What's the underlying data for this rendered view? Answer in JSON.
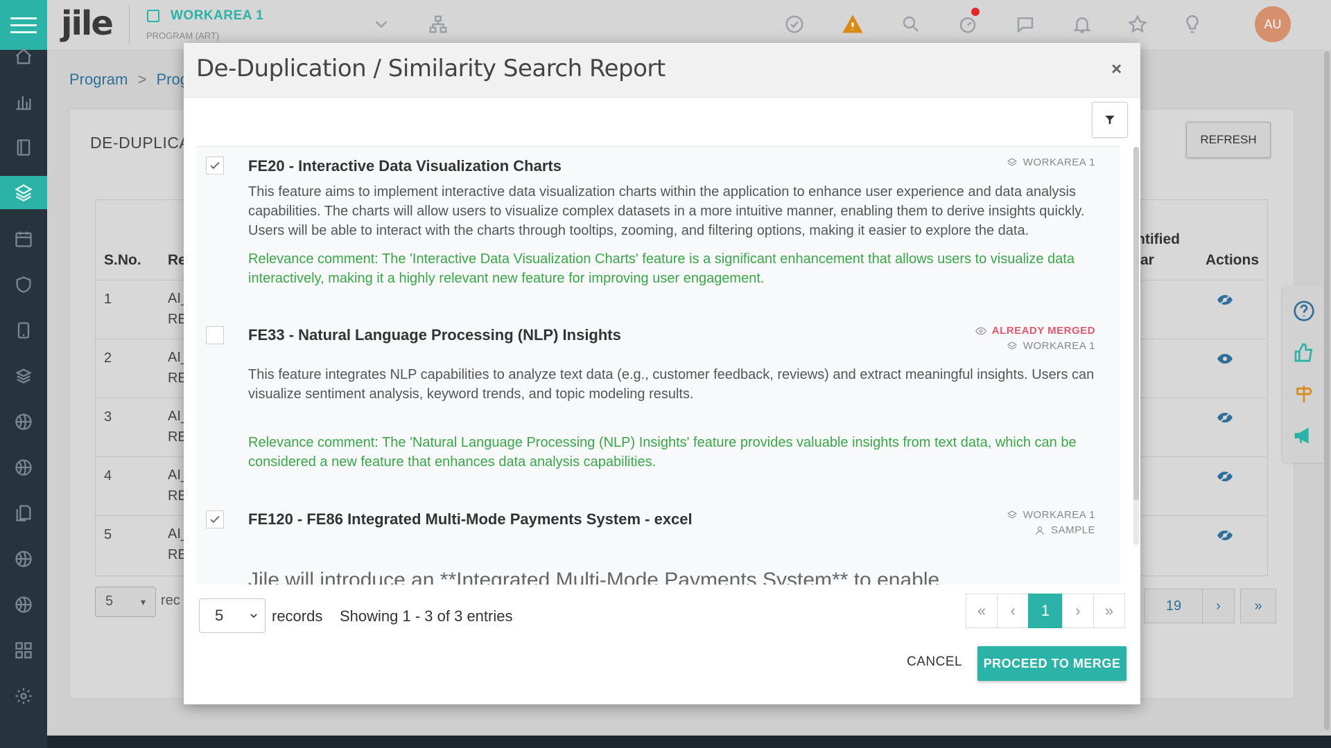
{
  "header": {
    "logo": "jile",
    "workarea_title": "WORKAREA 1",
    "workarea_sub": "PROGRAM (ART)",
    "avatar": "AU"
  },
  "background": {
    "breadcrumb": [
      "Program",
      ">",
      "Prog"
    ],
    "panel_title": "DE-DUPLICA",
    "refresh_label": "REFRESH",
    "columns": {
      "sno": "S.No.",
      "re": "Re",
      "identified_a": "ntified",
      "identified_b": "ar",
      "actions": "Actions"
    },
    "rows": [
      {
        "sn": "1",
        "a": "AI_",
        "b": "RE"
      },
      {
        "sn": "2",
        "a": "AI_",
        "b": "RE"
      },
      {
        "sn": "3",
        "a": "AI_",
        "b": "RE"
      },
      {
        "sn": "4",
        "a": "AI_",
        "b": "RE"
      },
      {
        "sn": "5",
        "a": "AI_",
        "b": "RE"
      }
    ],
    "page_size": "5",
    "records_label": "rec",
    "pages": [
      "19",
      "›",
      "»"
    ]
  },
  "modal": {
    "title": "De-Duplication / Similarity Search Report",
    "close": "×",
    "items": [
      {
        "checked": true,
        "title": "FE20 - Interactive Data Visualization Charts",
        "tags": [
          "WORKAREA 1"
        ],
        "description": "This feature aims to implement interactive data visualization charts within the application to enhance user experience and data analysis capabilities. The charts will allow users to visualize complex datasets in a more intuitive manner, enabling them to derive insights quickly. Users will be able to interact with the charts through tooltips, zooming, and filtering options, making it easier to explore the data.",
        "relevance": "Relevance comment: The 'Interactive Data Visualization Charts' feature is a significant enhancement that allows users to visualize data interactively, making it a highly relevant new feature for improving user engagement."
      },
      {
        "checked": false,
        "title": "FE33 - Natural Language Processing (NLP) Insights",
        "status": "ALREADY MERGED",
        "tags": [
          "WORKAREA 1"
        ],
        "description": "This feature integrates NLP capabilities to analyze text data (e.g., customer feedback, reviews) and extract meaningful insights. Users can visualize sentiment analysis, keyword trends, and topic modeling results.",
        "relevance": "Relevance comment: The 'Natural Language Processing (NLP) Insights' feature provides valuable insights from text data, which can be considered a new feature that enhances data analysis capabilities."
      },
      {
        "checked": true,
        "title": "FE120 - FE86 Integrated Multi-Mode Payments System - excel",
        "tags": [
          "WORKAREA 1",
          "SAMPLE"
        ],
        "description": "Jile will introduce an **Integrated Multi-Mode Payments System** to enable"
      }
    ],
    "footer": {
      "page_size": "5",
      "records_label": "records",
      "showing": "Showing 1 - 3 of 3 entries",
      "pager": [
        "«",
        "‹",
        "1",
        "›",
        "»"
      ],
      "cancel": "CANCEL",
      "proceed": "PROCEED TO MERGE"
    }
  },
  "colors": {
    "accent": "#2ab3a6",
    "relevance": "#3aa648",
    "merged": "#e4566c",
    "sidebar": "#27333d"
  }
}
